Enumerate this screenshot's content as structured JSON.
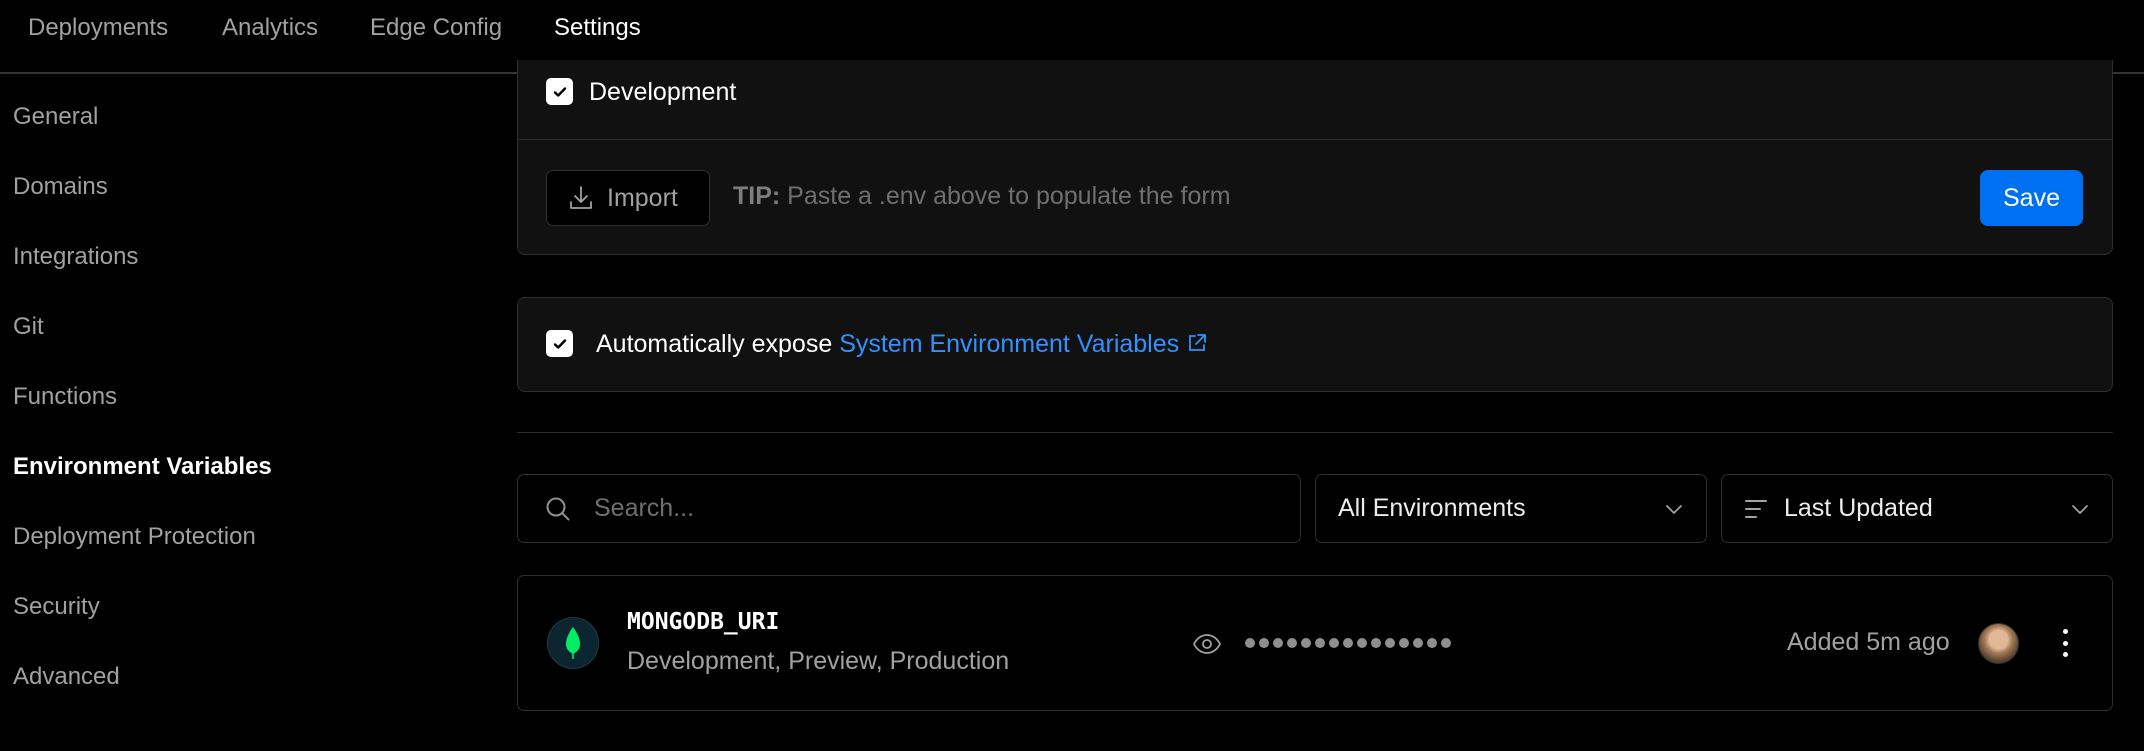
{
  "tabs": [
    {
      "label": "Deployments",
      "active": false
    },
    {
      "label": "Analytics",
      "active": false
    },
    {
      "label": "Edge Config",
      "active": false
    },
    {
      "label": "Settings",
      "active": true
    }
  ],
  "sidebar": {
    "items": [
      {
        "label": "General"
      },
      {
        "label": "Domains"
      },
      {
        "label": "Integrations"
      },
      {
        "label": "Git"
      },
      {
        "label": "Functions"
      },
      {
        "label": "Environment Variables",
        "active": true
      },
      {
        "label": "Deployment Protection"
      },
      {
        "label": "Security"
      },
      {
        "label": "Advanced"
      }
    ]
  },
  "form": {
    "environment_checkbox": {
      "label": "Development",
      "checked": true
    },
    "import_label": "Import",
    "tip_prefix": "TIP:",
    "tip_text": "Paste a .env above to populate the form",
    "save_label": "Save"
  },
  "system_vars": {
    "checked": true,
    "label": "Automatically expose",
    "link_text": "System Environment Variables"
  },
  "filters": {
    "search_placeholder": "Search...",
    "environment_select": "All Environments",
    "sort_select": "Last Updated"
  },
  "variables": [
    {
      "name": "MONGODB_URI",
      "environments": "Development, Preview, Production",
      "masked_value": "•••••••••••••••",
      "added": "Added 5m ago",
      "icon": "mongodb-leaf-icon"
    }
  ],
  "colors": {
    "accent": "#0070f3",
    "link": "#3291ff",
    "mongodb_green": "#00ed64"
  }
}
